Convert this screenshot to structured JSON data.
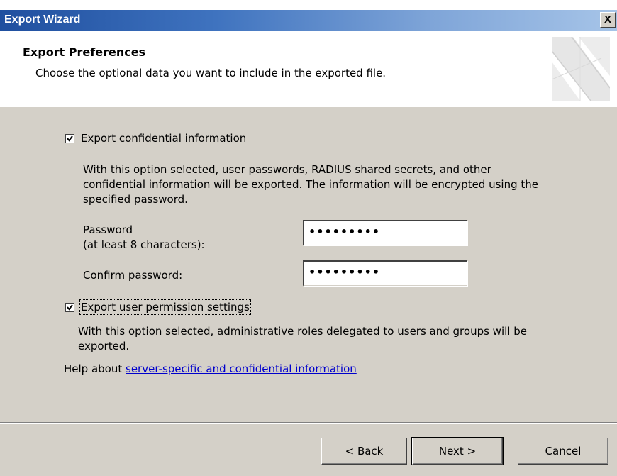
{
  "window": {
    "title": "Export Wizard",
    "close_label": "X"
  },
  "header": {
    "title": "Export Preferences",
    "subtitle": "Choose the optional data you want to include in the exported file."
  },
  "confidential": {
    "checked": true,
    "label": "Export confidential information",
    "description_line1": "With this option selected, user passwords, RADIUS shared secrets, and other",
    "description_line2": "confidential information will be exported. The information will be encrypted using the",
    "description_line3": "specified password.",
    "password_label_line1": "Password",
    "password_label_line2": "(at least 8 characters):",
    "password_value": "•••••••••",
    "confirm_label": "Confirm password:",
    "confirm_value": "•••••••••"
  },
  "permissions": {
    "checked": true,
    "label": "Export user permission settings",
    "description_line1": "With this option selected, administrative roles delegated to users and groups will be",
    "description_line2": "exported."
  },
  "help": {
    "prefix": "Help about ",
    "link": "server-specific and confidential information"
  },
  "buttons": {
    "back": "< Back",
    "next": "Next >",
    "cancel": "Cancel"
  }
}
